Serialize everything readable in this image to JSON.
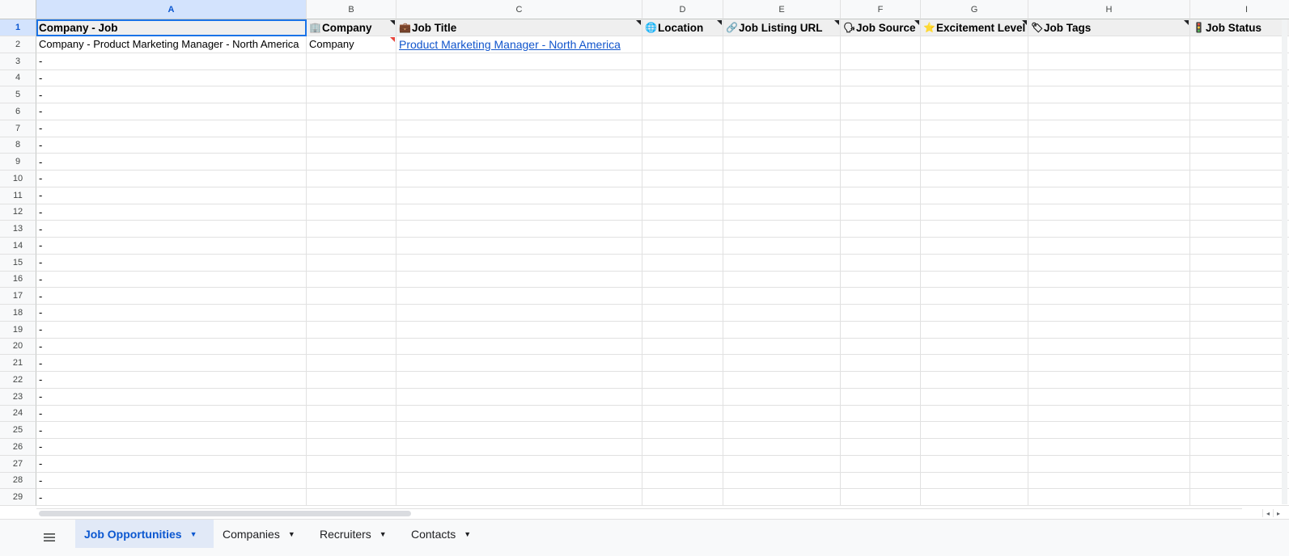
{
  "columns": [
    "A",
    "B",
    "C",
    "D",
    "E",
    "F",
    "G",
    "H",
    "I"
  ],
  "headers": [
    {
      "label": "Company - Job",
      "icon_name": "none",
      "icon": ""
    },
    {
      "label": "Company",
      "icon_name": "building-icon",
      "icon": "🏢"
    },
    {
      "label": "Job Title",
      "icon_name": "briefcase-icon",
      "icon": "💼"
    },
    {
      "label": "Location",
      "icon_name": "globe-icon",
      "icon": "🌐"
    },
    {
      "label": "Job Listing URL",
      "icon_name": "link-icon",
      "icon": "🔗"
    },
    {
      "label": "Job Source",
      "icon_name": "speaker-icon",
      "icon": "🗣"
    },
    {
      "label": "Excitement Level",
      "icon_name": "star-icon",
      "icon": "⭐"
    },
    {
      "label": "Job Tags",
      "icon_name": "tag-icon",
      "icon": "🏷"
    },
    {
      "label": "Job Status",
      "icon_name": "traffic-light-icon",
      "icon": "🚦"
    }
  ],
  "row2": {
    "company_job": "Company - Product Marketing Manager - North America",
    "company": "Company",
    "job_title": "Product Marketing Manager - North America"
  },
  "row_numbers": [
    "1",
    "2",
    "3",
    "4",
    "5",
    "6",
    "7",
    "8",
    "9",
    "10",
    "11",
    "12",
    "13",
    "14",
    "15",
    "16",
    "17",
    "18",
    "19",
    "20",
    "21",
    "22",
    "23",
    "24",
    "25",
    "26",
    "27",
    "28",
    "29"
  ],
  "placeholder_dash": "-",
  "sheet_tabs": [
    {
      "label": "Job Opportunities",
      "active": true
    },
    {
      "label": "Companies",
      "active": false
    },
    {
      "label": "Recruiters",
      "active": false
    },
    {
      "label": "Contacts",
      "active": false
    }
  ],
  "colors": {
    "accent": "#1a73e8",
    "link": "#1155cc",
    "header_fill": "#efefef"
  }
}
